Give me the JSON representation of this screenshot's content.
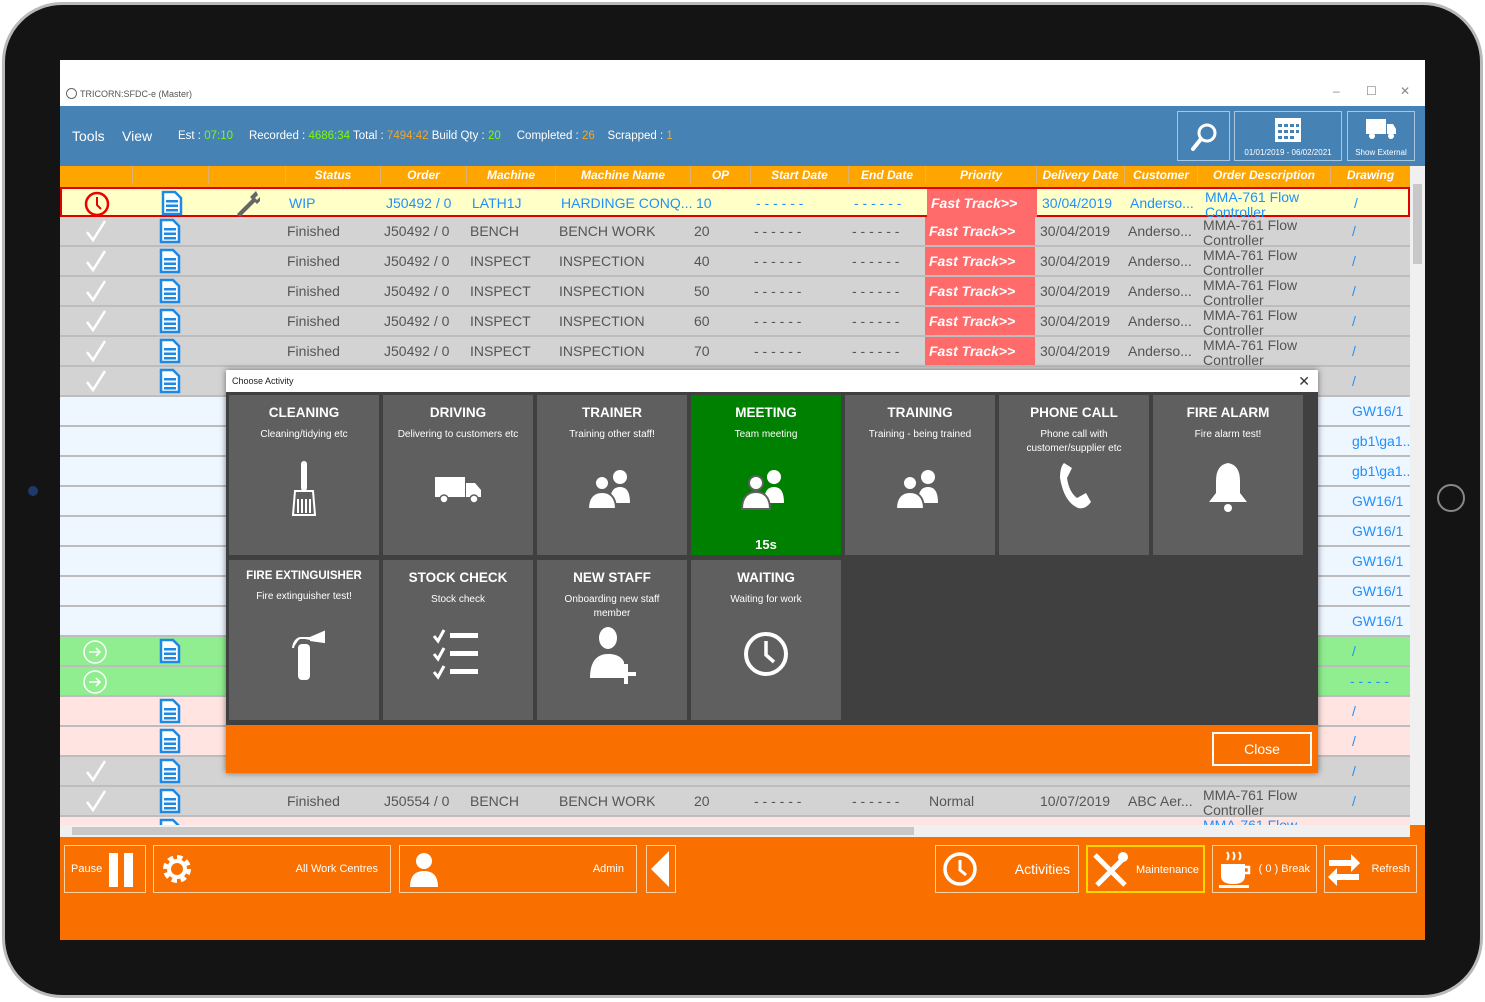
{
  "window": {
    "title": "TRICORN:SFDC-e (Master)",
    "minimize": "–",
    "maximize": "☐",
    "close": "✕"
  },
  "toolbar": {
    "menu": [
      "Tools",
      "View"
    ],
    "stats": {
      "est_label": "Est :",
      "est": "07:10",
      "recorded_label": "Recorded :",
      "recorded": "4686:34",
      "total_label": "Total :",
      "total": "7494:42",
      "build_label": "Build Qty :",
      "build": "20",
      "completed_label": "Completed :",
      "completed": "26",
      "scrapped_label": "Scrapped :",
      "scrapped": "1"
    },
    "date_range": "01/01/2019 - 06/02/2021",
    "show_external": "Show External"
  },
  "columns": [
    "Status",
    "Order",
    "Machine",
    "Machine Name",
    "OP",
    "Start Date",
    "End Date",
    "Priority",
    "Delivery Date",
    "Customer",
    "Order Description",
    "Drawing"
  ],
  "colors": {
    "wip": "#ffffc8",
    "finished": "#d3d3d3",
    "planned": "#eef6ff",
    "started": "#90ee90",
    "late": "#ffe4e1",
    "priority": "#ff6b6b",
    "header": "#ffa500",
    "toolbar": "#4682b4",
    "footer": "#f97000",
    "active_tile": "#008000"
  },
  "rows": [
    {
      "state": "wip",
      "icon": "clock-icon",
      "doc": true,
      "tool": true,
      "status": "WIP",
      "order": "J50492 / 0",
      "machine": "LATH1J",
      "machine_name": "HARDINGE CONQ...",
      "op": "10",
      "start": "- - - - - -",
      "end": "- - - - - -",
      "priority": "Fast Track>>",
      "delivery": "30/04/2019",
      "customer": "Anderso...",
      "desc": "MMA-761 Flow Controller",
      "drawing": "/"
    },
    {
      "state": "finished",
      "icon": "check-icon",
      "doc": true,
      "status": "Finished",
      "order": "J50492 / 0",
      "machine": "BENCH",
      "machine_name": "BENCH WORK",
      "op": "20",
      "start": "- - - - - -",
      "end": "- - - - - -",
      "priority": "Fast Track>>",
      "delivery": "30/04/2019",
      "customer": "Anderso...",
      "desc": "MMA-761 Flow Controller",
      "drawing": "/"
    },
    {
      "state": "finished",
      "icon": "check-icon",
      "doc": true,
      "status": "Finished",
      "order": "J50492 / 0",
      "machine": "INSPECT",
      "machine_name": "INSPECTION",
      "op": "40",
      "start": "- - - - - -",
      "end": "- - - - - -",
      "priority": "Fast Track>>",
      "delivery": "30/04/2019",
      "customer": "Anderso...",
      "desc": "MMA-761 Flow Controller",
      "drawing": "/"
    },
    {
      "state": "finished",
      "icon": "check-icon",
      "doc": true,
      "status": "Finished",
      "order": "J50492 / 0",
      "machine": "INSPECT",
      "machine_name": "INSPECTION",
      "op": "50",
      "start": "- - - - - -",
      "end": "- - - - - -",
      "priority": "Fast Track>>",
      "delivery": "30/04/2019",
      "customer": "Anderso...",
      "desc": "MMA-761 Flow Controller",
      "drawing": "/"
    },
    {
      "state": "finished",
      "icon": "check-icon",
      "doc": true,
      "status": "Finished",
      "order": "J50492 / 0",
      "machine": "INSPECT",
      "machine_name": "INSPECTION",
      "op": "60",
      "start": "- - - - - -",
      "end": "- - - - - -",
      "priority": "Fast Track>>",
      "delivery": "30/04/2019",
      "customer": "Anderso...",
      "desc": "MMA-761 Flow Controller",
      "drawing": "/"
    },
    {
      "state": "finished",
      "icon": "check-icon",
      "doc": true,
      "status": "Finished",
      "order": "J50492 / 0",
      "machine": "INSPECT",
      "machine_name": "INSPECTION",
      "op": "70",
      "start": "- - - - - -",
      "end": "- - - - - -",
      "priority": "Fast Track>>",
      "delivery": "30/04/2019",
      "customer": "Anderso...",
      "desc": "MMA-761 Flow Controller",
      "drawing": "/"
    },
    {
      "state": "finished",
      "icon": "check-icon",
      "doc": true,
      "drawing": "/"
    },
    {
      "state": "planned",
      "drawing": "GW16/1"
    },
    {
      "state": "planned",
      "drawing": "gb1\\ga1..."
    },
    {
      "state": "planned",
      "drawing": "gb1\\ga1..."
    },
    {
      "state": "planned",
      "drawing": "GW16/1"
    },
    {
      "state": "planned",
      "drawing": "GW16/1"
    },
    {
      "state": "planned",
      "drawing": "GW16/1"
    },
    {
      "state": "planned",
      "drawing": "GW16/1"
    },
    {
      "state": "planned",
      "drawing": "GW16/1"
    },
    {
      "state": "started",
      "icon": "arrow-circle-icon",
      "doc": true,
      "drawing": "/"
    },
    {
      "state": "started",
      "icon": "arrow-circle-icon",
      "drawing": "- - - - -"
    },
    {
      "state": "late",
      "doc": true,
      "drawing": "/"
    },
    {
      "state": "late",
      "doc": true,
      "drawing": "/"
    },
    {
      "state": "finished",
      "icon": "check-icon",
      "doc": true,
      "drawing": "/"
    },
    {
      "state": "finished",
      "icon": "check-icon",
      "doc": true,
      "status": "Finished",
      "order": "J50554 / 0",
      "machine": "BENCH",
      "machine_name": "BENCH WORK",
      "op": "20",
      "start": "- - - - - -",
      "end": "- - - - - -",
      "priority_plain": "Normal",
      "delivery": "10/07/2019",
      "customer": "ABC Aer...",
      "desc": "MMA-761 Flow Controller",
      "drawing": "/"
    },
    {
      "state": "late",
      "doc": true,
      "desc": "MMA-761 Flow"
    }
  ],
  "dialog": {
    "title": "Choose Activity",
    "close_label": "Close",
    "activities": [
      {
        "name": "CLEANING",
        "desc": "Cleaning/tidying etc",
        "icon": "broom-icon"
      },
      {
        "name": "DRIVING",
        "desc": "Delivering to customers etc",
        "icon": "truck-icon"
      },
      {
        "name": "TRAINER",
        "desc": "Training other staff!",
        "icon": "people-icon"
      },
      {
        "name": "MEETING",
        "desc": "Team meeting",
        "icon": "people-icon",
        "active": true,
        "timer": "15s"
      },
      {
        "name": "TRAINING",
        "desc": "Training - being trained",
        "icon": "people-icon"
      },
      {
        "name": "PHONE CALL",
        "desc": "Phone call with customer/supplier etc",
        "icon": "phone-icon"
      },
      {
        "name": "FIRE ALARM",
        "desc": "Fire alarm test!",
        "icon": "bell-icon"
      },
      {
        "name": "FIRE EXTINGUISHER",
        "desc": "Fire extinguisher test!",
        "icon": "extinguisher-icon"
      },
      {
        "name": "STOCK CHECK",
        "desc": "Stock check",
        "icon": "checklist-icon"
      },
      {
        "name": "NEW STAFF",
        "desc": "Onboarding new staff member",
        "icon": "add-user-icon"
      },
      {
        "name": "WAITING",
        "desc": "Waiting for work",
        "icon": "clock-icon"
      }
    ]
  },
  "footer": {
    "pause": "Pause",
    "work_centres": "All Work Centres",
    "user": "Admin",
    "activities": "Activities",
    "maintenance": "Maintenance",
    "break": "( 0 )  Break",
    "refresh": "Refresh"
  }
}
